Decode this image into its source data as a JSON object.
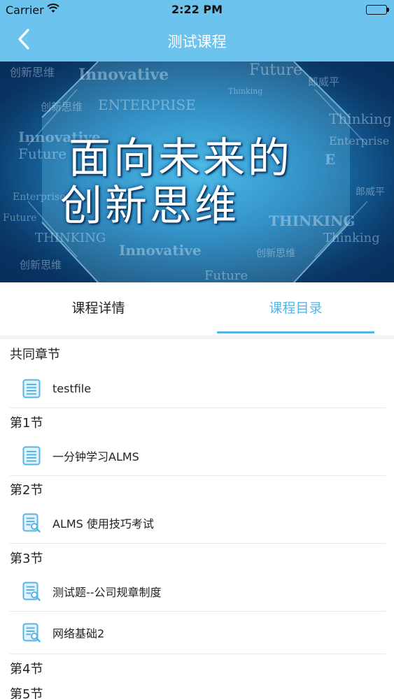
{
  "status_bar": {
    "carrier": "Carrier",
    "time": "2:22 PM"
  },
  "nav": {
    "title": "测试课程",
    "back_icon": "chevron-left-icon"
  },
  "banner": {
    "headline_line1": "面向未来的",
    "headline_line2": "创新思维",
    "watermarks": [
      "创新思维",
      "Innovative",
      "Future",
      "郎威平",
      "Thinking",
      "创新思维",
      "ENTERPRISE",
      "Innovative",
      "Thinking",
      "Future",
      "Enterprise",
      "E",
      "郎威平",
      "Enterprise",
      "Future",
      "THINKING",
      "THINKING",
      "Thinking",
      "Innovative",
      "创新思维",
      "Future",
      "创新思维"
    ]
  },
  "tabs": [
    {
      "label": "课程详情",
      "active": false
    },
    {
      "label": "课程目录",
      "active": true
    }
  ],
  "colors": {
    "header": "#6bc3ee",
    "accent": "#56b4e6"
  },
  "catalog": [
    {
      "section": "共同章节",
      "items": [
        {
          "label": "testfile",
          "icon": "document-icon"
        }
      ]
    },
    {
      "section": "第1节",
      "items": [
        {
          "label": "一分钟学习ALMS",
          "icon": "document-icon"
        }
      ]
    },
    {
      "section": "第2节",
      "items": [
        {
          "label": "ALMS 使用技巧考试",
          "icon": "exam-icon"
        }
      ]
    },
    {
      "section": "第3节",
      "items": [
        {
          "label": "测试题--公司规章制度",
          "icon": "exam-icon"
        },
        {
          "label": "网络基础2",
          "icon": "exam-icon"
        }
      ]
    },
    {
      "section": "第4节",
      "items": []
    },
    {
      "section": "第5节",
      "items": []
    }
  ]
}
